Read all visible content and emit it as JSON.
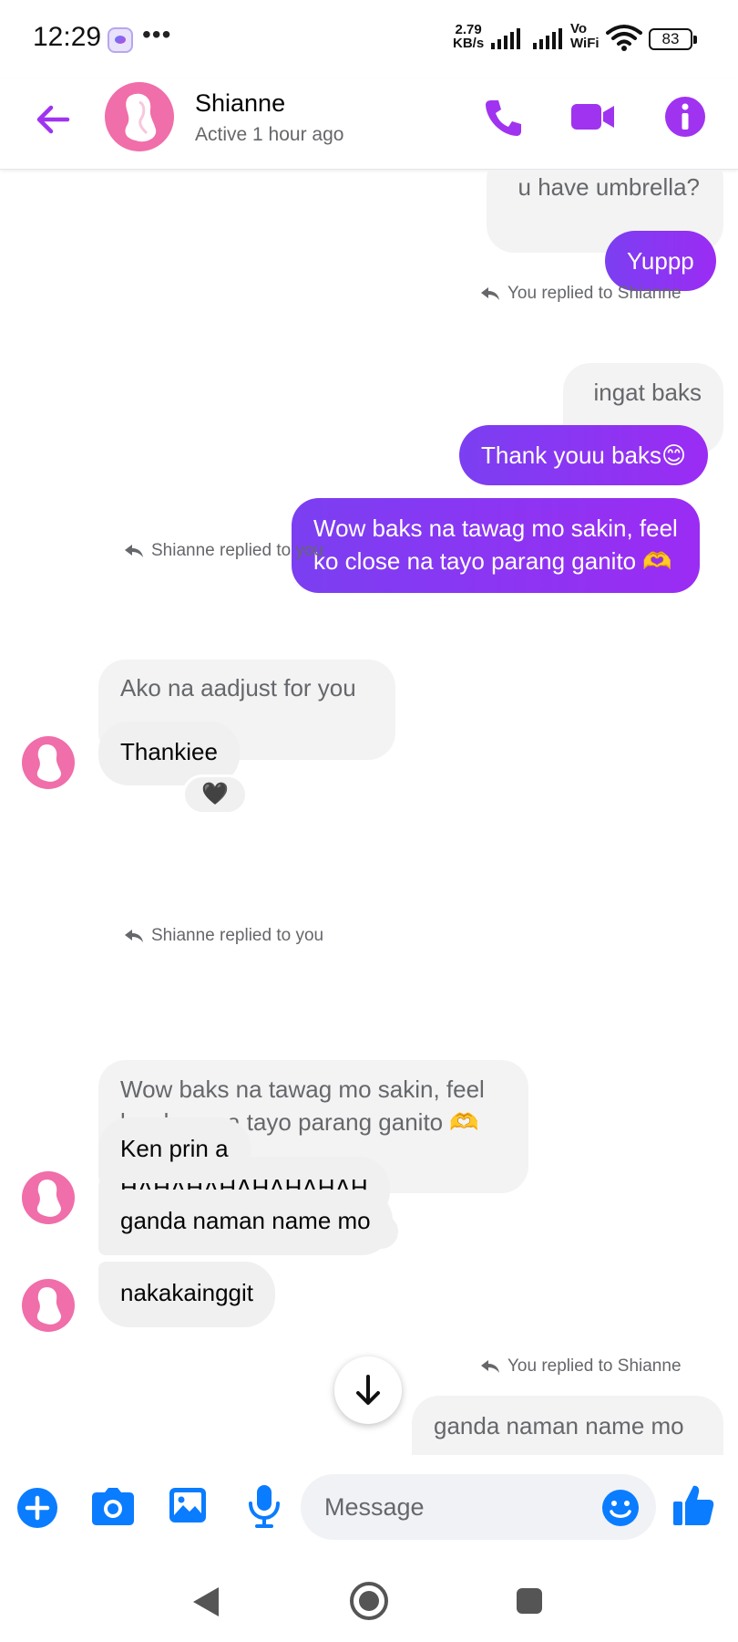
{
  "status_bar": {
    "time": "12:29",
    "net_speed_value": "2.79",
    "net_speed_unit": "KB/s",
    "vowifi_top": "Vo",
    "vowifi_bottom": "WiFi",
    "battery": "83"
  },
  "header": {
    "name": "Shianne",
    "status": "Active 1 hour ago"
  },
  "messages": {
    "m1": "u have umbrella?",
    "m2": "Yuppp",
    "r1_label": "You replied to Shianne",
    "m3": "ingat baks",
    "m4": "Thank youu baks😊",
    "m5_l1": "Wow baks na tawag mo sakin, feel",
    "m5_l2": "ko close na tayo parang ganito 🫶",
    "r2_label": "Shianne replied to you",
    "m6": "Ako na aadjust for you",
    "m7": "Thankiee",
    "react1": "🖤",
    "r3_label": "Shianne replied to you",
    "m8_l1": "Wow baks na tawag mo sakin, feel",
    "m8_l2": "ko close na tayo parang ganito 🫶",
    "m9": "HAHAHAHAHAHAHAH",
    "react2": "😆",
    "m10": "Ken prin a",
    "m11": "ganda naman name mo",
    "m12": "nakakainggit",
    "r4_label": "You replied to Shianne",
    "m13": "ganda naman name mo"
  },
  "composer": {
    "placeholder": "Message"
  },
  "colors": {
    "accent": "#a033f0",
    "bubble_out": "#8f2cf2",
    "bubble_in": "#f0f0f0",
    "composer_icons": "#0a7cff"
  },
  "icons": {
    "back": "back-arrow-icon",
    "call": "phone-icon",
    "video": "video-camera-icon",
    "info": "info-icon",
    "plus": "plus-icon",
    "camera": "camera-icon",
    "gallery": "image-icon",
    "mic": "microphone-icon",
    "emoji": "emoji-icon",
    "like": "thumbs-up-icon"
  }
}
